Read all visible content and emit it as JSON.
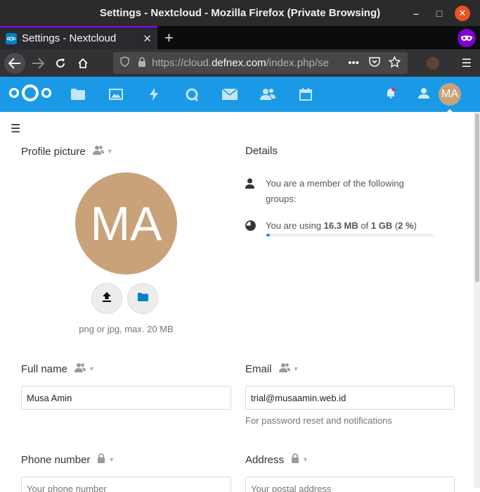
{
  "window": {
    "title": "Settings - Nextcloud - Mozilla Firefox (Private Browsing)",
    "min_glyph": "–",
    "max_glyph": "□",
    "close_glyph": "✕"
  },
  "browser": {
    "tab_title": "Settings - Nextcloud",
    "tab_close": "✕",
    "new_tab": "+",
    "url_prefix": "https://cloud.",
    "url_domain": "defnex.com",
    "url_suffix": "/index.php/se",
    "more": "•••",
    "menu": "☰"
  },
  "nextcloud": {
    "apps": [
      "files-icon",
      "photos-icon",
      "activity-icon",
      "talk-icon",
      "mail-icon",
      "contacts-icon",
      "calendar-icon"
    ],
    "user_initials": "MA",
    "accent": "#1a9ae6"
  },
  "settings": {
    "menu_glyph": "☰",
    "profile_picture": {
      "title": "Profile picture",
      "initials": "MA",
      "hint": "png or jpg, max. 20 MB",
      "avatar_color": "#c9a27a"
    },
    "details": {
      "title": "Details",
      "groups_text": "You are a member of the following groups:",
      "usage_prefix": "You are using ",
      "usage_used": "16.3 MB",
      "usage_of": " of ",
      "usage_total": "1 GB",
      "usage_pct_open": " (",
      "usage_pct": "2 %",
      "usage_pct_close": ")",
      "usage_fraction": 0.02
    },
    "full_name": {
      "label": "Full name",
      "value": "Musa Amin"
    },
    "email": {
      "label": "Email",
      "value": "trial@musaamin.web.id",
      "note": "For password reset and notifications"
    },
    "phone": {
      "label": "Phone number",
      "placeholder": "Your phone number"
    },
    "address": {
      "label": "Address",
      "placeholder": "Your postal address"
    }
  }
}
